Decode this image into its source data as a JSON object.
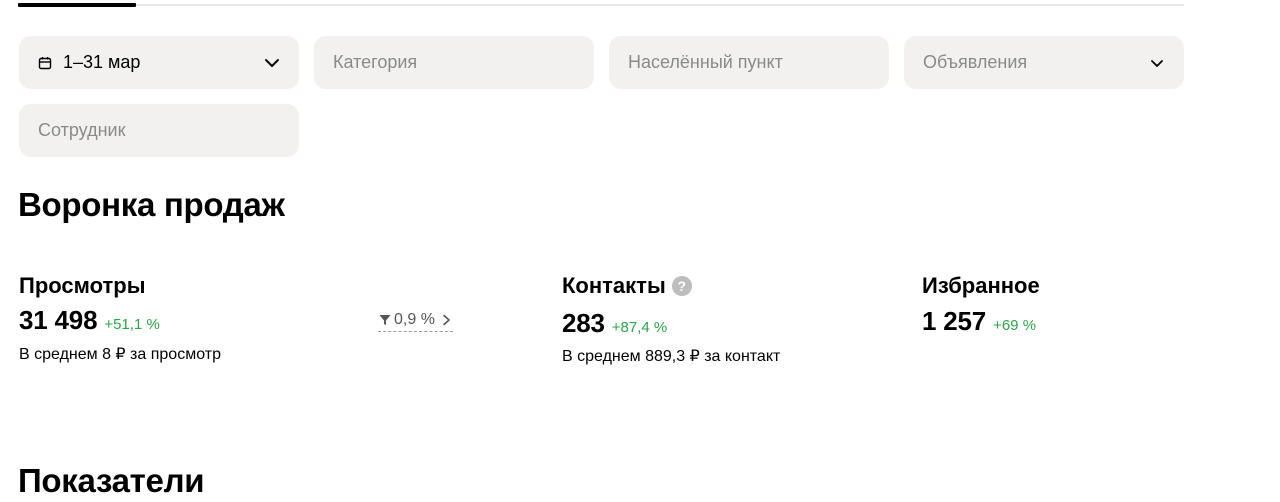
{
  "filters": {
    "date_range": "1–31 мар",
    "category_placeholder": "Категория",
    "locality_placeholder": "Населённый пункт",
    "listings_placeholder": "Объявления",
    "employee_placeholder": "Сотрудник"
  },
  "funnel": {
    "title": "Воронка продаж",
    "views": {
      "label": "Просмотры",
      "value": "31 498",
      "delta": "+51,1 %",
      "avg": "В среднем 8 ₽ за просмотр"
    },
    "conversion": {
      "value": "0,9 %"
    },
    "contacts": {
      "label": "Контакты",
      "help": "?",
      "value": "283",
      "delta": "+87,4 %",
      "avg": "В среднем 889,3 ₽ за контакт"
    },
    "favorites": {
      "label": "Избранное",
      "value": "1 257",
      "delta": "+69 %"
    }
  },
  "indicators": {
    "title": "Показатели"
  },
  "colors": {
    "positive_delta": "#2aa54a",
    "field_bg": "#f2f1f0",
    "help_icon": "#bdbdbd"
  }
}
